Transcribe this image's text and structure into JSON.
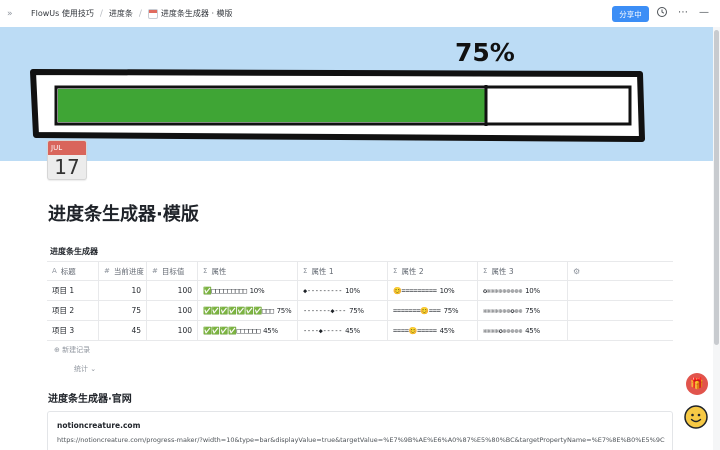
{
  "topbar": {
    "collapse_icon": "double-chevron-right-icon",
    "breadcrumb": [
      "FlowUs 使用技巧",
      "进度条",
      "进度条生成器 · 模版"
    ],
    "share_label": "分享中",
    "icons": [
      "clock-icon",
      "more-icon",
      "minimize-icon"
    ]
  },
  "cover": {
    "percent_text": "75%",
    "progress": 0.75,
    "fill_color": "#3fa535"
  },
  "page": {
    "icon_month": "JUL",
    "icon_day": "17",
    "title": "进度条生成器·模版"
  },
  "database": {
    "title": "进度条生成器",
    "columns": [
      {
        "icon": "A",
        "label": "标题"
      },
      {
        "icon": "#",
        "label": "当前进度"
      },
      {
        "icon": "#",
        "label": "目标值"
      },
      {
        "icon": "Σ",
        "label": "属性"
      },
      {
        "icon": "Σ",
        "label": "属性 1"
      },
      {
        "icon": "Σ",
        "label": "属性 2"
      },
      {
        "icon": "Σ",
        "label": "属性 3"
      }
    ],
    "add_column_icon": "settings-icon",
    "rows": [
      {
        "title": "项目 1",
        "current": "10",
        "target": "100",
        "p0": "✅□□□□□□□□□",
        "p0_label": "10%",
        "p1": "◆---------",
        "p1_label": "10%",
        "p2": "😊=========",
        "p2_label": "10%",
        "p3": "✪❊❊❊❊❊❊❊❊❊",
        "p3_label": "10%"
      },
      {
        "title": "项目 2",
        "current": "75",
        "target": "100",
        "p0": "✅✅✅✅✅✅✅□□□",
        "p0_label": "75%",
        "p1": "-------◆---",
        "p1_label": "75%",
        "p2": "=======😊===",
        "p2_label": "75%",
        "p3": "❊❊❊❊❊❊❊✪❊❊",
        "p3_label": "75%"
      },
      {
        "title": "项目 3",
        "current": "45",
        "target": "100",
        "p0": "✅✅✅✅□□□□□□",
        "p0_label": "45%",
        "p1": "----◆-----",
        "p1_label": "45%",
        "p2": "====😊=====",
        "p2_label": "45%",
        "p3": "❊❊❊❊✪❊❊❊❊❊",
        "p3_label": "45%"
      }
    ],
    "new_record": "新建记录",
    "stats": "统计 ⌄"
  },
  "official": {
    "title": "进度条生成器·官网",
    "domain": "notioncreature.com",
    "url": "https://notioncreature.com/progress-maker/?width=10&type=bar&displayValue=true&targetValue=%E7%9B%AE%E6%A0%87%E5%80%BC&targetPropertyName=%E7%8E%B0%E5%9C%A8%E8%BF%9B%E5%..."
  },
  "floating": {
    "gift_icon": "gift-icon",
    "assistant_icon": "smiley-assistant-icon"
  }
}
